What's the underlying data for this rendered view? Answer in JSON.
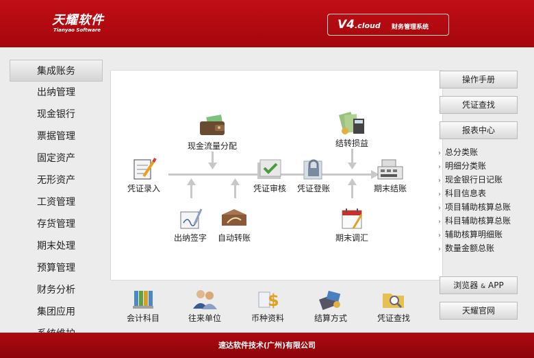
{
  "header": {
    "logo_name": "天耀软件",
    "logo_sub": "Tianyao Software",
    "version_main": "V4",
    "version_suffix": ".cloud",
    "system_name": "财务管理系统",
    "colors": {
      "brand_red": "#b20a10",
      "footer_red": "#9a060c"
    }
  },
  "sidebar": {
    "items": [
      {
        "label": "集成账务"
      },
      {
        "label": "出纳管理"
      },
      {
        "label": "现金银行"
      },
      {
        "label": "票据管理"
      },
      {
        "label": "固定资产"
      },
      {
        "label": "无形资产"
      },
      {
        "label": "工资管理"
      },
      {
        "label": "存货管理"
      },
      {
        "label": "期末处理"
      },
      {
        "label": "预算管理"
      },
      {
        "label": "财务分析"
      },
      {
        "label": "集团应用"
      },
      {
        "label": "系统维护"
      }
    ]
  },
  "flow": {
    "nodes": {
      "voucher_entry": {
        "label": "凭证录入",
        "icon": "notepad-pen-icon"
      },
      "cashflow_alloc": {
        "label": "现金流量分配",
        "icon": "wallet-icon"
      },
      "cashier_sign": {
        "label": "出纳签字",
        "icon": "signature-icon"
      },
      "auto_transfer": {
        "label": "自动转账",
        "icon": "auto-transfer-icon"
      },
      "voucher_review": {
        "label": "凭证审核",
        "icon": "check-folder-icon"
      },
      "voucher_post": {
        "label": "凭证登账",
        "icon": "lock-ledger-icon"
      },
      "pl_transfer": {
        "label": "结转损益",
        "icon": "money-calculator-icon"
      },
      "period_adjust": {
        "label": "期末调汇",
        "icon": "calendar-icon"
      },
      "period_close": {
        "label": "期末结账",
        "icon": "cash-register-icon"
      }
    }
  },
  "bottom": {
    "items": [
      {
        "label": "会计科目",
        "icon": "binders-icon"
      },
      {
        "label": "往来单位",
        "icon": "people-icon"
      },
      {
        "label": "币种资料",
        "icon": "dollar-icon"
      },
      {
        "label": "结算方式",
        "icon": "card-payment-icon"
      },
      {
        "label": "凭证查找",
        "icon": "folder-search-icon"
      }
    ]
  },
  "right": {
    "manual": "操作手册",
    "voucher_search": "凭证查找",
    "report_center": "报表中心",
    "reports": [
      {
        "label": "总分类账"
      },
      {
        "label": "明细分类账"
      },
      {
        "label": "现金银行日记账"
      },
      {
        "label": "科目信息表"
      },
      {
        "label": "项目辅助核算总账"
      },
      {
        "label": "科目辅助核算总账"
      },
      {
        "label": "辅助核算明细账"
      },
      {
        "label": "数量金额总账"
      }
    ],
    "browser_app_pre": "浏览器",
    "browser_app_amp": "&",
    "browser_app_post": "APP",
    "official_site": "天耀官网"
  },
  "footer": {
    "company": "速达软件技术(广州)有限公司"
  }
}
